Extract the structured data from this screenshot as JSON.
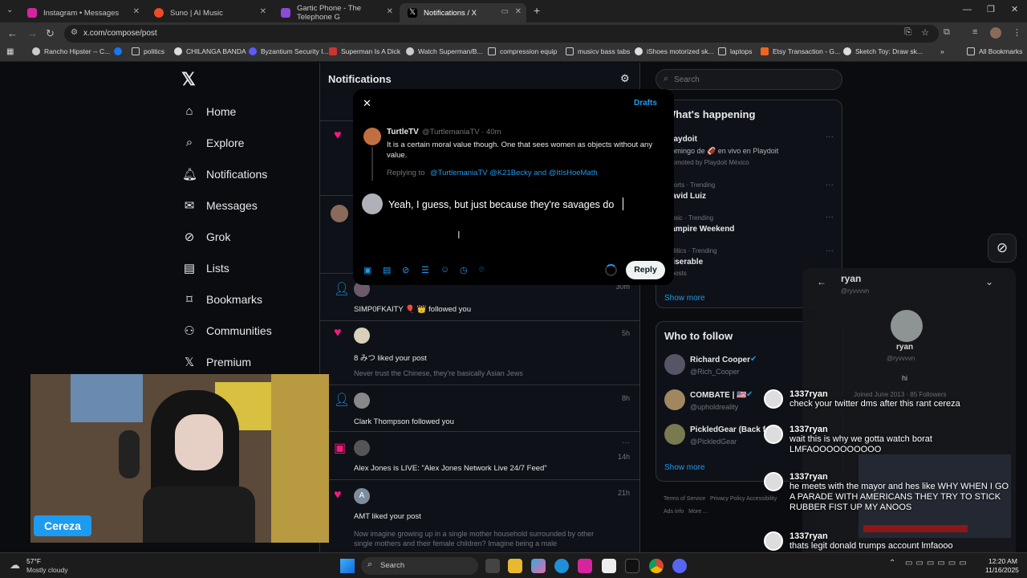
{
  "browser": {
    "tabs": [
      {
        "title": "Instagram • Messages",
        "color": "#d6249f"
      },
      {
        "title": "Suno | AI Music",
        "color": "#f04a26"
      },
      {
        "title": "Gartic Phone - The Telephone G",
        "color": "#8a4bd6"
      },
      {
        "title": "Notifications / X",
        "color": "#000000"
      }
    ],
    "url": "x.com/compose/post",
    "bookmarks": [
      "Rancho Hipster -- C...",
      "politics",
      "CHILANGA BANDA",
      "Byzantium Security I...",
      "Superman Is A Dick",
      "Watch Superman/B...",
      "compression equip",
      "musicv bass tabs",
      "iShoes motorized sk...",
      "laptops",
      "Etsy Transaction - G...",
      "Sketch Toy: Draw sk..."
    ],
    "all_bookmarks": "All Bookmarks"
  },
  "x": {
    "nav": [
      "Home",
      "Explore",
      "Notifications",
      "Messages",
      "Grok",
      "Lists",
      "Bookmarks",
      "Communities",
      "Premium"
    ],
    "feed_title": "Notifications",
    "notifications": [
      {
        "text": "SIMP0FKAITY 🎈 👑 followed you",
        "sub": "",
        "time": "30m"
      },
      {
        "text": "8 みつ liked your post",
        "sub": "Never trust the Chinese, they're basically Asian Jews",
        "time": "5h"
      },
      {
        "text": "Clark Thompson followed you",
        "sub": "",
        "time": "8h"
      },
      {
        "text": "Alex Jones is LIVE: \"Alex Jones Network Live 24/7 Feed\"",
        "sub": "",
        "time": "14h"
      },
      {
        "text": "AMT liked your post",
        "sub": "Now imagine growing up in a single mother household surrounded by other single mothers and their female children? Imagine being a male",
        "time": "21h"
      }
    ],
    "search_placeholder": "Search",
    "whats_happening": "What's happening",
    "trends": [
      {
        "meta": "",
        "name": "Playdoit",
        "extra": "Domingo de 🏈 en vivo en Playdoit",
        "extra2": "Promoted by Playdoit México"
      },
      {
        "meta": "Sports · Trending",
        "name": "David Luiz"
      },
      {
        "meta": "Music · Trending",
        "name": "Vampire Weekend"
      },
      {
        "meta": "Politics · Trending",
        "name": "Miserable",
        "extra": "4 posts"
      }
    ],
    "show_more": "Show more",
    "who_to_follow": "Who to follow",
    "follow": [
      {
        "name": "Richard Cooper",
        "handle": "@Rich_Cooper"
      },
      {
        "name": "COMBATE | 🇺🇸",
        "handle": "@upholdreality"
      },
      {
        "name": "PickledGear (Back f",
        "handle": "@PickledGear"
      }
    ],
    "footer": [
      "Terms of Service",
      "Privacy Policy",
      "Cookie Policy",
      "Accessibility",
      "Ads info",
      "More ..."
    ]
  },
  "compose": {
    "drafts": "Drafts",
    "orig_author": "TurtleTV",
    "orig_handle": "@TurtlemaniaTV · 40m",
    "orig_text": "It is a certain moral value though. One that sees women as objects without any value.",
    "replying_label": "Replying to",
    "replying_to": "@TurtlemaniaTV @K21Becky and @ItIsHoeMath",
    "reply_text": "Yeah, I guess, but just because they're savages do",
    "reply_button": "Reply"
  },
  "chat": {
    "name": "ryan",
    "handle": "@ryvvvvn",
    "greeting": "hi",
    "joined": "Joined June 2013 · 85 Followers",
    "messages": [
      {
        "user": "1337ryan",
        "text": "check your twitter dms after this rant cereza"
      },
      {
        "user": "1337ryan",
        "text": "wait this is why we gotta watch borat LMFAOOOOOOOOOO"
      },
      {
        "user": "1337ryan",
        "text": "he meets with the mayor and hes like WHY WHEN I GO A PARADE WITH AMERICANS THEY TRY TO STICK RUBBER FIST UP MY ANOOS"
      },
      {
        "user": "1337ryan",
        "text": "thats legit donald trumps account lmfaooo"
      }
    ]
  },
  "webcam": {
    "name": "Cereza"
  },
  "taskbar": {
    "weather_temp": "57°F",
    "weather_desc": "Mostly cloudy",
    "search": "Search",
    "time": "12:20 AM",
    "date": "11/16/2025"
  }
}
